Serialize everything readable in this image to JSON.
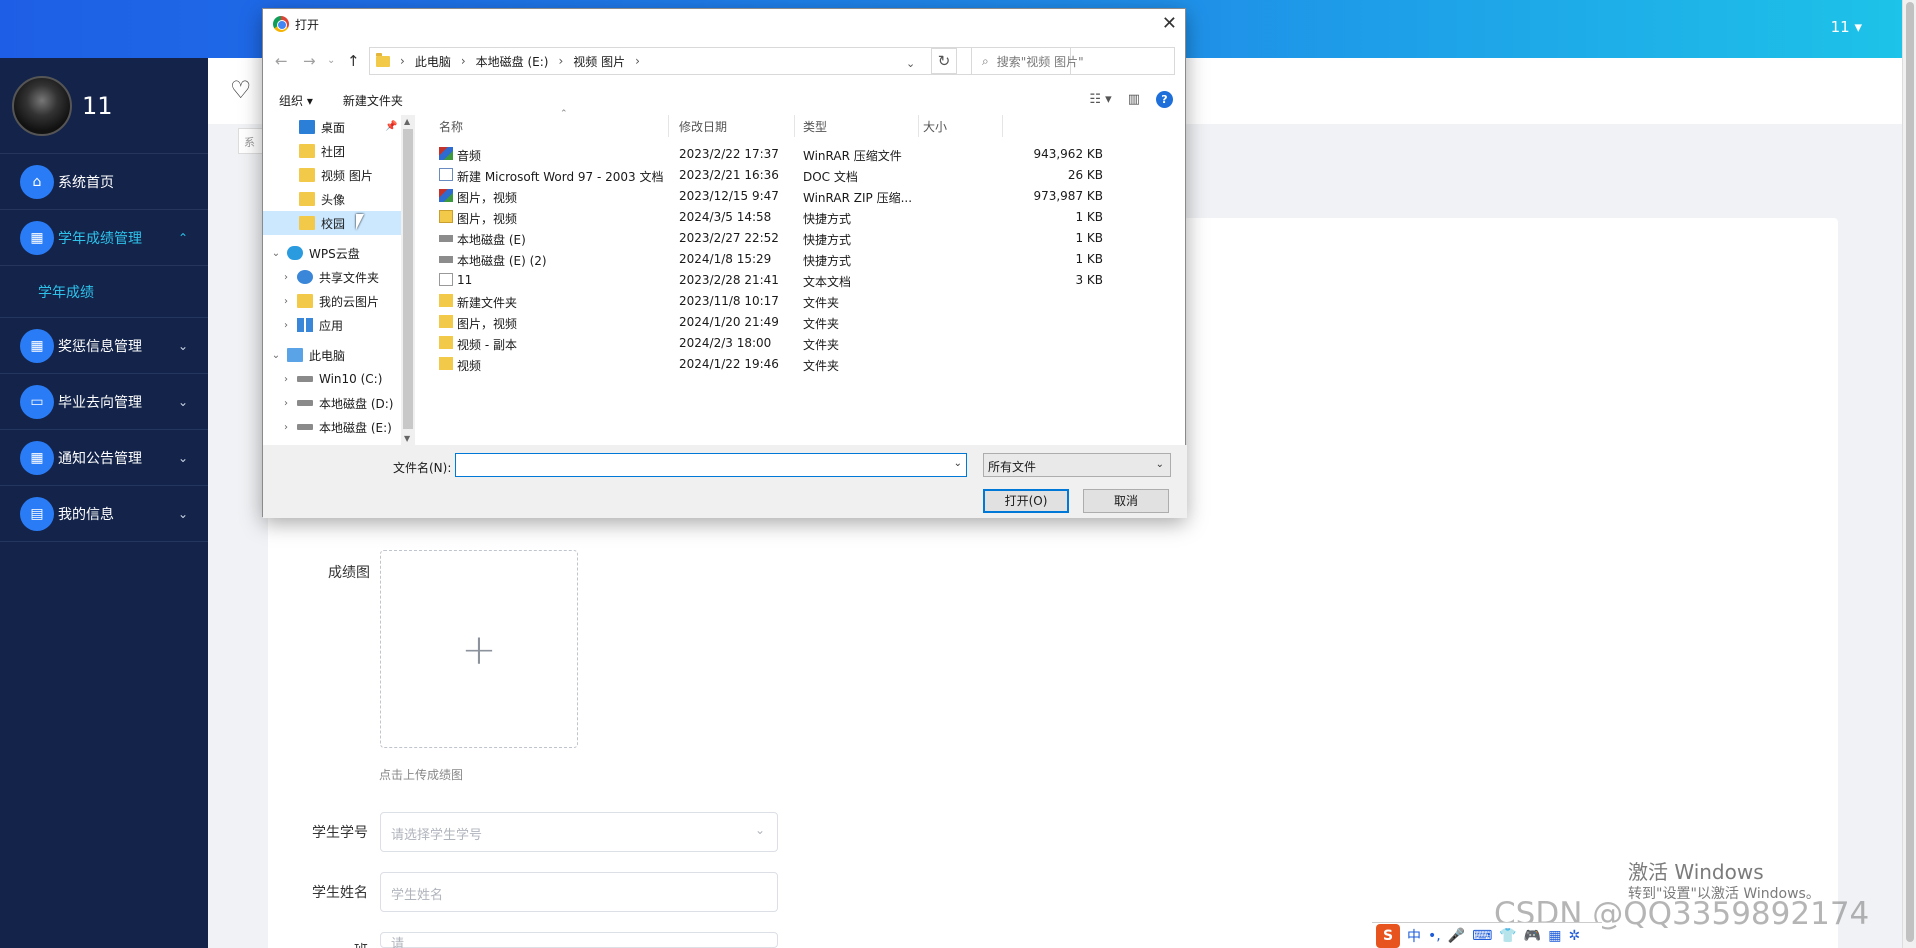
{
  "topbar": {
    "user": "11 ▾"
  },
  "sidebar": {
    "user_name": "11",
    "items": [
      {
        "label": "系统首页",
        "icon": "home-icon"
      },
      {
        "label": "学年成绩管理",
        "icon": "grid-icon",
        "chev": "⌃"
      },
      {
        "label": "学年成绩"
      },
      {
        "label": "奖惩信息管理",
        "icon": "grid-icon",
        "chev": "⌄"
      },
      {
        "label": "毕业去向管理",
        "icon": "monitor-icon",
        "chev": "⌄"
      },
      {
        "label": "通知公告管理",
        "icon": "grid-icon",
        "chev": "⌄"
      },
      {
        "label": "我的信息",
        "icon": "card-icon",
        "chev": "⌄"
      }
    ]
  },
  "main": {
    "crumb": "系",
    "upload_label": "成绩图",
    "upload_plus": "+",
    "upload_hint": "点击上传成绩图",
    "student_no_label": "学生学号",
    "student_no_placeholder": "请选择学生学号",
    "student_name_label": "学生姓名",
    "student_name_placeholder": "学生姓名",
    "third_label": "班",
    "third_placeholder": "请"
  },
  "watermark": {
    "line1": "激活 Windows",
    "line2": "转到\"设置\"以激活 Windows。"
  },
  "csdn": "CSDN @QQ3359892174",
  "ime": {
    "s": "S",
    "mode": "中",
    "punct": "•,",
    "mic": "🎤",
    "kbd": "⌨",
    "shirt": "👕",
    "game": "🎮",
    "grid": "▦",
    "gear": "✲"
  },
  "dialog": {
    "title": "打开",
    "crumbs": [
      "此电脑",
      "本地磁盘 (E:)",
      "视频 图片"
    ],
    "search_placeholder": "搜索\"视频 图片\"",
    "toolbar": {
      "organize": "组织 ▾",
      "new_folder": "新建文件夹"
    },
    "tree": [
      {
        "label": "桌面",
        "icon": "desktop",
        "exp": ""
      },
      {
        "label": "社团",
        "icon": "folder",
        "exp": ""
      },
      {
        "label": "视频 图片",
        "icon": "folder",
        "exp": ""
      },
      {
        "label": "头像",
        "icon": "folder",
        "exp": ""
      },
      {
        "label": "校园",
        "icon": "folder",
        "exp": "",
        "selected": true
      },
      {
        "label": "WPS云盘",
        "icon": "cloud",
        "exp": "⌄"
      },
      {
        "label": "共享文件夹",
        "icon": "share",
        "exp": "›"
      },
      {
        "label": "我的云图片",
        "icon": "folder",
        "exp": "›"
      },
      {
        "label": "应用",
        "icon": "apps",
        "exp": "›"
      },
      {
        "label": "此电脑",
        "icon": "pc",
        "exp": "⌄"
      },
      {
        "label": "Win10 (C:)",
        "icon": "drive",
        "exp": "›"
      },
      {
        "label": "本地磁盘 (D:)",
        "icon": "drive",
        "exp": "›"
      },
      {
        "label": "本地磁盘 (E:)",
        "icon": "drive",
        "exp": "›"
      }
    ],
    "columns": {
      "name": "名称",
      "date": "修改日期",
      "type": "类型",
      "size": "大小"
    },
    "files": [
      {
        "name": "音频",
        "date": "2023/2/22 17:37",
        "type": "WinRAR 压缩文件",
        "size": "943,962 KB",
        "icon": "rar"
      },
      {
        "name": "新建 Microsoft Word 97 - 2003 文档",
        "date": "2023/2/21 16:36",
        "type": "DOC 文档",
        "size": "26 KB",
        "icon": "doc"
      },
      {
        "name": "图片，视频",
        "date": "2023/12/15 9:47",
        "type": "WinRAR ZIP 压缩...",
        "size": "973,987 KB",
        "icon": "rar"
      },
      {
        "name": "图片，视频",
        "date": "2024/3/5 14:58",
        "type": "快捷方式",
        "size": "1 KB",
        "icon": "lnk"
      },
      {
        "name": "本地磁盘 (E)",
        "date": "2023/2/27 22:52",
        "type": "快捷方式",
        "size": "1 KB",
        "icon": "drv"
      },
      {
        "name": "本地磁盘 (E) (2)",
        "date": "2024/1/8 15:29",
        "type": "快捷方式",
        "size": "1 KB",
        "icon": "drv"
      },
      {
        "name": "11",
        "date": "2023/2/28 21:41",
        "type": "文本文档",
        "size": "3 KB",
        "icon": "txt"
      },
      {
        "name": "新建文件夹",
        "date": "2023/11/8 10:17",
        "type": "文件夹",
        "size": "",
        "icon": "fld"
      },
      {
        "name": "图片，视频",
        "date": "2024/1/20 21:49",
        "type": "文件夹",
        "size": "",
        "icon": "fld"
      },
      {
        "name": "视频 - 副本",
        "date": "2024/2/3 18:00",
        "type": "文件夹",
        "size": "",
        "icon": "fld"
      },
      {
        "name": "视频",
        "date": "2024/1/22 19:46",
        "type": "文件夹",
        "size": "",
        "icon": "fld"
      }
    ],
    "filename_label": "文件名(N):",
    "filename_value": "",
    "filetype": "所有文件",
    "open_button": "打开(O)",
    "cancel_button": "取消"
  }
}
